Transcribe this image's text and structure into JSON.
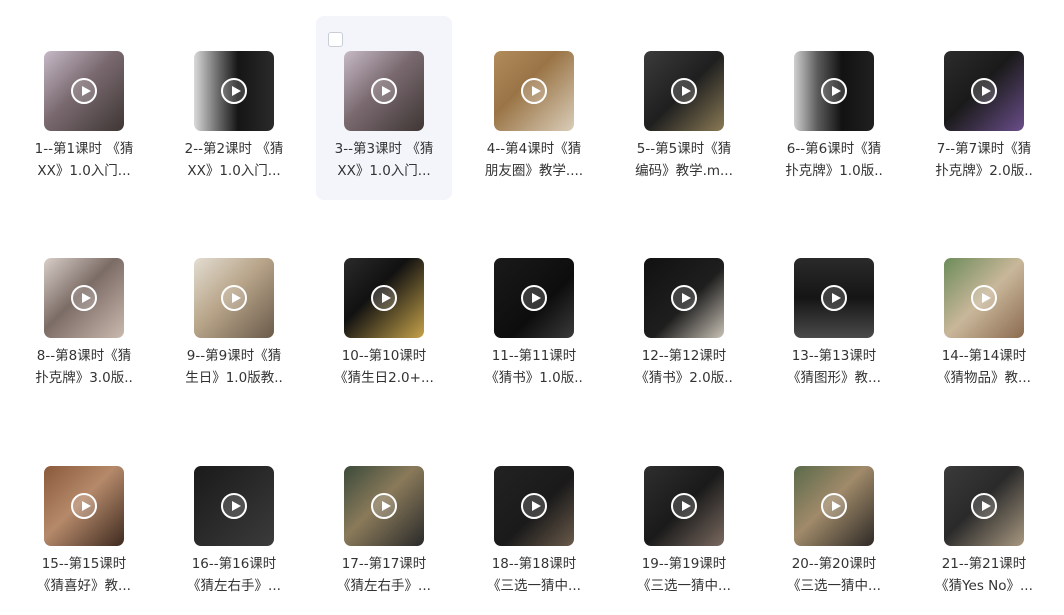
{
  "files": [
    {
      "line1": "1--第1课时 《猜",
      "line2": "XX》1.0入门...",
      "bg": "linear-gradient(135deg,#c6b9c7 0%,#7a6a70 45%,#3e3634 100%)",
      "selected": false
    },
    {
      "line1": "2--第2课时 《猜",
      "line2": "XX》1.0入门...",
      "bg": "linear-gradient(90deg,#d9d9d9 0%,#6b6b6b 30%,#151515 55%,#2a2a2a 100%)",
      "selected": false
    },
    {
      "line1": "3--第3课时 《猜",
      "line2": "XX》1.0入门...",
      "bg": "linear-gradient(135deg,#c7bac6 0%,#7a6a70 45%,#3e3634 100%)",
      "selected": true
    },
    {
      "line1": "4--第4课时《猜",
      "line2": "朋友圈》教学....",
      "bg": "linear-gradient(135deg,#b28b5b 0%,#9a7446 40%,#d9cdb8 100%)",
      "selected": false
    },
    {
      "line1": "5--第5课时《猜",
      "line2": "编码》教学.m...",
      "bg": "linear-gradient(135deg,#3b3b3b 0%,#1f1f1f 50%,#8a7a55 100%)",
      "selected": false
    },
    {
      "line1": "6--第6课时《猜",
      "line2": "扑克牌》1.0版..",
      "bg": "linear-gradient(90deg,#cfcfcf 0%,#5a5a5a 30%,#121212 60%,#202020 100%)",
      "selected": false
    },
    {
      "line1": "7--第7课时《猜",
      "line2": "扑克牌》2.0版..",
      "bg": "linear-gradient(135deg,#2c2c2c 0%,#1a1a1a 45%,#6a4e8a 100%)",
      "selected": false
    },
    {
      "line1": "8--第8课时《猜",
      "line2": "扑克牌》3.0版..",
      "bg": "linear-gradient(135deg,#d8cfc8 0%,#7c6c66 45%,#c9b9ae 100%)",
      "selected": false
    },
    {
      "line1": "9--第9课时《猜",
      "line2": "生日》1.0版教..",
      "bg": "linear-gradient(135deg,#e3ddd2 0%,#b8a58a 45%,#6a5a4a 100%)",
      "selected": false
    },
    {
      "line1": "10--第10课时",
      "line2": "《猜生日2.0+...",
      "bg": "linear-gradient(135deg,#2a2a2a 0%,#111 40%,#c6a34a 100%)",
      "selected": false
    },
    {
      "line1": "11--第11课时",
      "line2": "《猜书》1.0版..",
      "bg": "linear-gradient(135deg,#1a1a1a 0%,#0d0d0d 60%,#3a3a3a 100%)",
      "selected": false
    },
    {
      "line1": "12--第12课时",
      "line2": "《猜书》2.0版..",
      "bg": "linear-gradient(135deg,#111 0%,#1e1e1e 55%,#c9c2b6 100%)",
      "selected": false
    },
    {
      "line1": "13--第13课时",
      "line2": "《猜图形》教...",
      "bg": "linear-gradient(180deg,#2a2a2a 0%,#151515 50%,#4a4a4a 100%)",
      "selected": false
    },
    {
      "line1": "14--第14课时",
      "line2": "《猜物品》教...",
      "bg": "linear-gradient(135deg,#6c8c5a 0%,#c9b79a 50%,#8b6a50 100%)",
      "selected": false
    },
    {
      "line1": "15--第15课时",
      "line2": "《猜喜好》教...",
      "bg": "linear-gradient(135deg,#8a5a3a 0%,#b5896a 45%,#3e2a20 100%)",
      "selected": false
    },
    {
      "line1": "16--第16课时",
      "line2": "《猜左右手》...",
      "bg": "linear-gradient(135deg,#1a1a1a 0%,#2a2a2a 50%,#3b3b3b 100%)",
      "selected": false
    },
    {
      "line1": "17--第17课时",
      "line2": "《猜左右手》...",
      "bg": "linear-gradient(135deg,#3b4a3a 0%,#8a7a5a 45%,#2a2a2a 100%)",
      "selected": false
    },
    {
      "line1": "18--第18课时",
      "line2": "《三选一猜中...",
      "bg": "linear-gradient(135deg,#222 0%,#1a1a1a 55%,#6a5a4a 100%)",
      "selected": false
    },
    {
      "line1": "19--第19课时",
      "line2": "《三选一猜中...",
      "bg": "linear-gradient(135deg,#2e2e2e 0%,#1a1a1a 50%,#7a6a60 100%)",
      "selected": false
    },
    {
      "line1": "20--第20课时",
      "line2": "《三选一猜中...",
      "bg": "linear-gradient(135deg,#5a6a4a 0%,#a08a6a 45%,#2e2a26 100%)",
      "selected": false
    },
    {
      "line1": "21--第21课时",
      "line2": "《猜Yes No》...",
      "bg": "linear-gradient(135deg,#3a3a3a 0%,#2a2a2a 45%,#a89880 100%)",
      "selected": false
    }
  ]
}
